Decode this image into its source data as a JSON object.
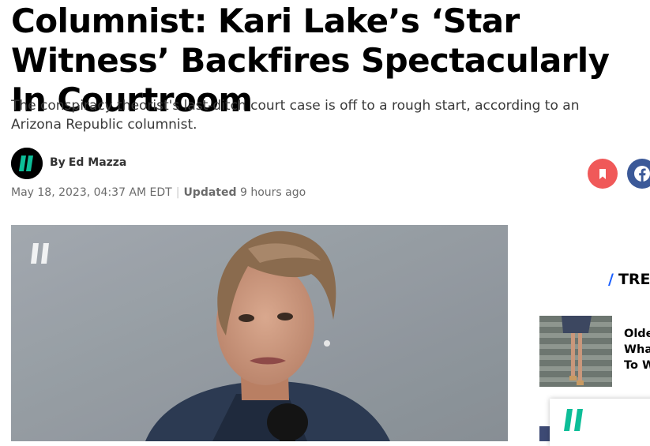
{
  "article": {
    "headline": "Columnist: Kari Lake’s ‘Star Witness’ Backfires Spectacularly In Courtroom",
    "dek": "The conspiracy theorist's last-ditch court case is off to a rough start, according to an Arizona Republic columnist.",
    "byline_prefix": "By",
    "author": "Ed Mazza",
    "published": "May 18, 2023, 04:37 AM EDT",
    "separator": "|",
    "updated_label": "Updated",
    "updated_value": "9 hours ago"
  },
  "share": {
    "save_icon": "bookmark-icon",
    "facebook_icon": "facebook-icon"
  },
  "sidebar": {
    "trending_slash": "/",
    "trending_label": "TREN",
    "trending_items": [
      {
        "title": "Olde\nWha\nTo W"
      }
    ]
  },
  "colors": {
    "brand_green": "#0dbe98",
    "save_red": "#f05959",
    "facebook_blue": "#3b5998",
    "accent_blue": "#1a5fff"
  }
}
